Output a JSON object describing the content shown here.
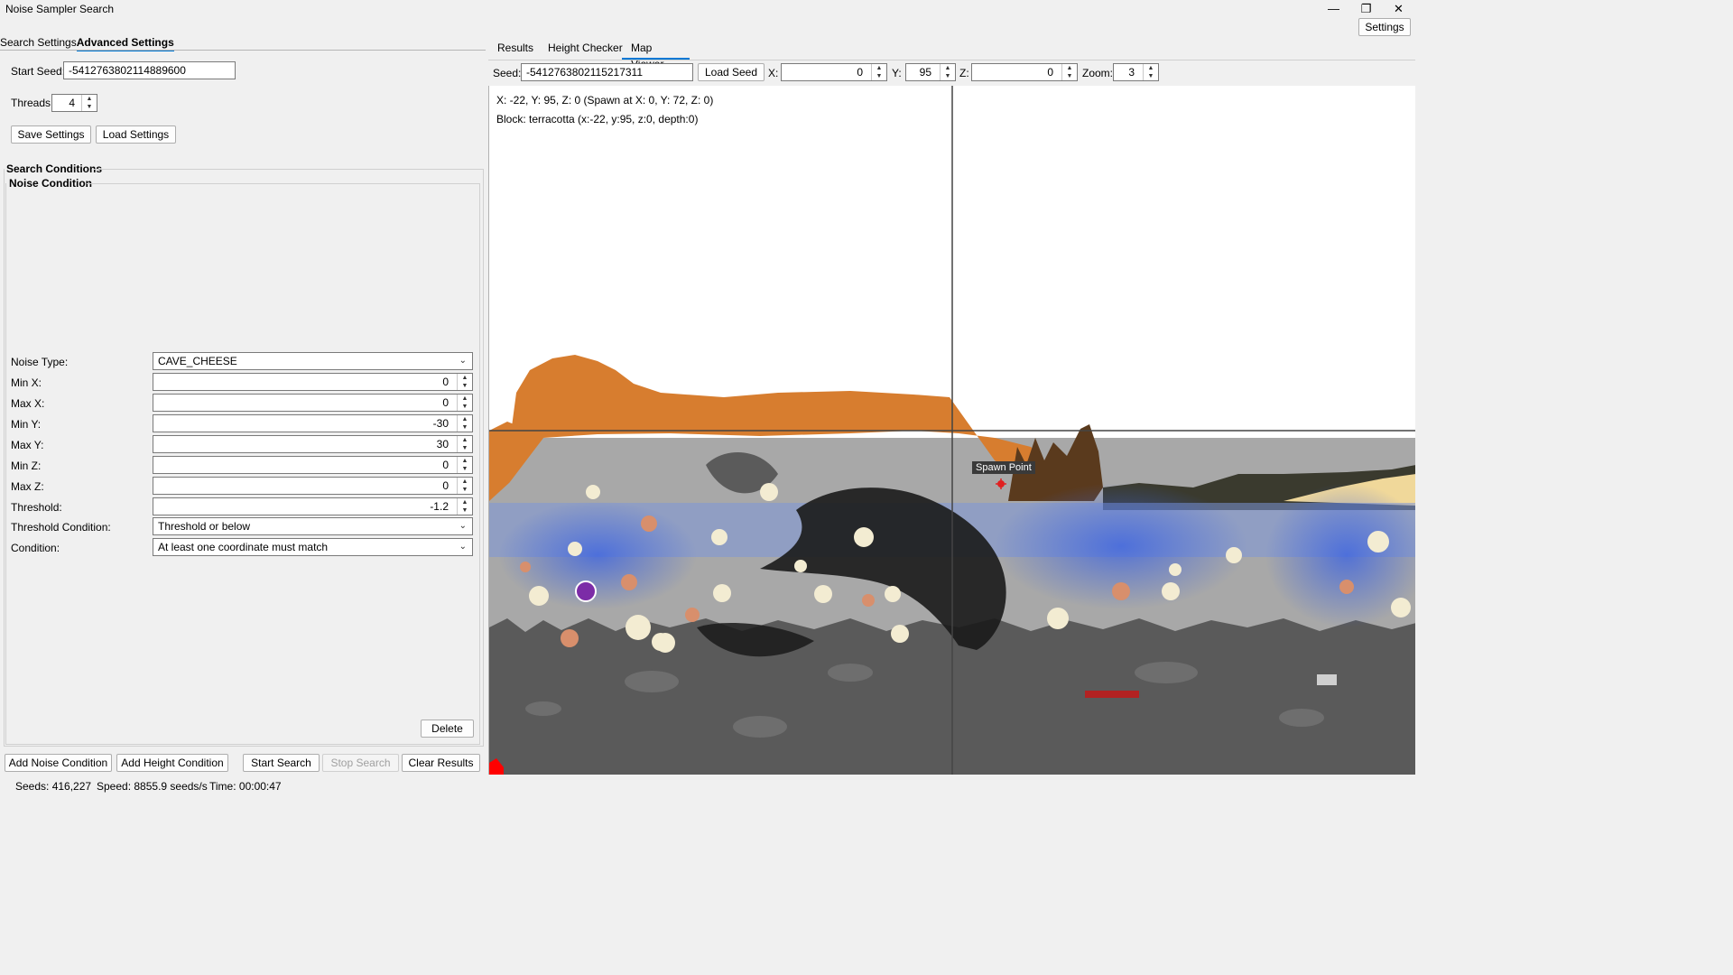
{
  "window": {
    "title": "Noise Sampler Search",
    "minimize": "—",
    "maximize": "❐",
    "close": "✕"
  },
  "header": {
    "settings_label": "Settings"
  },
  "left_tabs": {
    "search_settings": "Search Settings",
    "advanced_settings": "Advanced Settings"
  },
  "left": {
    "start_seed_label": "Start Seed:",
    "start_seed_value": "-5412763802114889600",
    "threads_label": "Threads:",
    "threads_value": "4",
    "save_settings": "Save Settings",
    "load_settings": "Load Settings",
    "search_conditions": "Search Conditions",
    "noise_condition": "Noise Condition",
    "fields": [
      {
        "label": "Noise Type:",
        "value": "CAVE_CHEESE",
        "kind": "combo"
      },
      {
        "label": "Min X:",
        "value": "0",
        "kind": "num"
      },
      {
        "label": "Max X:",
        "value": "0",
        "kind": "num"
      },
      {
        "label": "Min Y:",
        "value": "-30",
        "kind": "num"
      },
      {
        "label": "Max Y:",
        "value": "30",
        "kind": "num"
      },
      {
        "label": "Min Z:",
        "value": "0",
        "kind": "num"
      },
      {
        "label": "Max Z:",
        "value": "0",
        "kind": "num"
      },
      {
        "label": "Threshold:",
        "value": "-1.2",
        "kind": "num"
      },
      {
        "label": "Threshold Condition:",
        "value": "Threshold or below",
        "kind": "combo"
      },
      {
        "label": "Condition:",
        "value": "At least one coordinate must match",
        "kind": "combo"
      }
    ],
    "delete": "Delete"
  },
  "bottom_buttons": {
    "add_noise": "Add Noise Condition",
    "add_height": "Add Height Condition",
    "start": "Start Search",
    "stop": "Stop Search",
    "clear": "Clear Results"
  },
  "status": {
    "seeds": "Seeds: 416,227",
    "speed": "Speed: 8855.9 seeds/s",
    "time": "Time: 00:00:47"
  },
  "right_tabs": {
    "results": "Results",
    "height_checker": "Height Checker",
    "map_viewer": "Map Viewer"
  },
  "viewer": {
    "seed_label": "Seed:",
    "seed_value": "-5412763802115217311",
    "load_seed": "Load Seed",
    "x_label": "X:",
    "x_value": "0",
    "y_label": "Y:",
    "y_value": "95",
    "z_label": "Z:",
    "z_value": "0",
    "zoom_label": "Zoom:",
    "zoom_value": "3",
    "info_line1": "X: -22, Y: 95, Z: 0 (Spawn at X: 0, Y: 72, Z: 0)",
    "info_line2": "Block: terracotta (x:-22, y:95, z:0, depth:0)",
    "spawn_label": "Spawn Point"
  },
  "colors": {
    "accent": "#0078d4",
    "terracotta": "#d77d2f",
    "stone": "#a9a9a9",
    "deepslate": "#595959",
    "water": "#4a6fd8"
  }
}
